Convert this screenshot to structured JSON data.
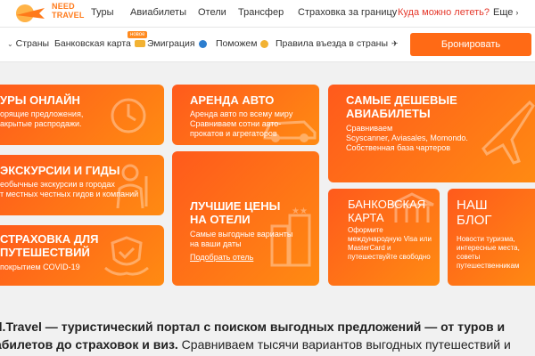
{
  "brand": {
    "line1": "NEED",
    "line2": "TRAVEL"
  },
  "nav": [
    {
      "label": "Туры"
    },
    {
      "label": "Авиабилеты"
    },
    {
      "label": "Отели"
    },
    {
      "label": "Трансфер"
    },
    {
      "label": "Страховка за границу"
    },
    {
      "label": "Куда можно лететь?"
    },
    {
      "label": "Еще"
    }
  ],
  "subnav": [
    {
      "label": "Страны"
    },
    {
      "label": "Банковская карта"
    },
    {
      "label": "Эмиграция"
    },
    {
      "label": "Поможем"
    },
    {
      "label": "Правила въезда в страны"
    }
  ],
  "badge": "новое",
  "book_button": "Бронировать",
  "tiles": {
    "tours": {
      "title": "УРЫ ОНЛАЙН",
      "text": "орящие предложения,\nакрытые распродажи."
    },
    "excursions": {
      "title": "ЭКСКУРСИИ И ГИДЫ",
      "text": "еобычные экскурсии в городах\nт местных честных гидов и компаний"
    },
    "insurance": {
      "title": "СТРАХОВКА ДЛЯ\nПУТЕШЕСТВИЙ",
      "text": "покрытием COVID-19"
    },
    "car": {
      "title": "АРЕНДА АВТО",
      "text": "Аренда авто по всему миру\nСравниваем сотни авто-\nпрокатов и агрегаторов"
    },
    "hotels": {
      "title": "ЛУЧШИЕ ЦЕНЫ\nНА ОТЕЛИ",
      "text": "Самые выгодные варианты\nна ваши даты",
      "link": "Подобрать отель"
    },
    "flights": {
      "title": "САМЫЕ ДЕШЕВЫЕ\nАВИАБИЛЕТЫ",
      "text": "Сравниваем\nScyscanner, Aviasales, Momondo.\nСобственная база чартеров"
    },
    "bank": {
      "title": "БАНКОВСКАЯ\nКАРТА",
      "text": "Оформите\nмеждународную Visa или\nMasterCard и\nпутешествуйте свободно"
    },
    "blog": {
      "title": "НАШ\nБЛОГ",
      "text": "Новости туризма,\nинтересные места,\nсоветы путешественникам"
    }
  },
  "bottom": {
    "bold1": "d.Travel — туристический портал с поиском выгодных предложений — от туров и",
    "bold2": "абилетов до страховок и виз.",
    "rest": " Сравниваем тысячи вариантов выгодных путешествий и"
  }
}
